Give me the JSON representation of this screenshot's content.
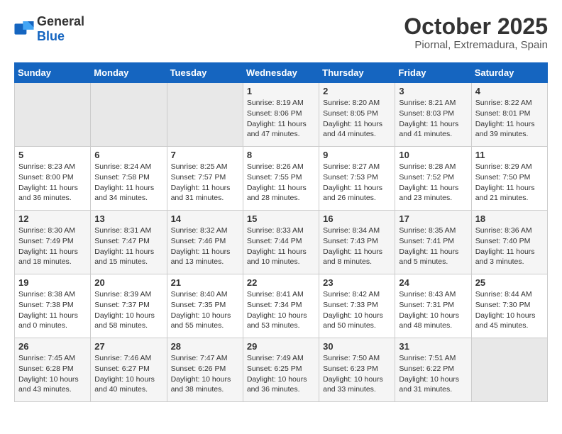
{
  "header": {
    "logo_general": "General",
    "logo_blue": "Blue",
    "month_title": "October 2025",
    "location": "Piornal, Extremadura, Spain"
  },
  "days_of_week": [
    "Sunday",
    "Monday",
    "Tuesday",
    "Wednesday",
    "Thursday",
    "Friday",
    "Saturday"
  ],
  "weeks": [
    [
      {
        "day": "",
        "info": ""
      },
      {
        "day": "",
        "info": ""
      },
      {
        "day": "",
        "info": ""
      },
      {
        "day": "1",
        "info": "Sunrise: 8:19 AM\nSunset: 8:06 PM\nDaylight: 11 hours and 47 minutes."
      },
      {
        "day": "2",
        "info": "Sunrise: 8:20 AM\nSunset: 8:05 PM\nDaylight: 11 hours and 44 minutes."
      },
      {
        "day": "3",
        "info": "Sunrise: 8:21 AM\nSunset: 8:03 PM\nDaylight: 11 hours and 41 minutes."
      },
      {
        "day": "4",
        "info": "Sunrise: 8:22 AM\nSunset: 8:01 PM\nDaylight: 11 hours and 39 minutes."
      }
    ],
    [
      {
        "day": "5",
        "info": "Sunrise: 8:23 AM\nSunset: 8:00 PM\nDaylight: 11 hours and 36 minutes."
      },
      {
        "day": "6",
        "info": "Sunrise: 8:24 AM\nSunset: 7:58 PM\nDaylight: 11 hours and 34 minutes."
      },
      {
        "day": "7",
        "info": "Sunrise: 8:25 AM\nSunset: 7:57 PM\nDaylight: 11 hours and 31 minutes."
      },
      {
        "day": "8",
        "info": "Sunrise: 8:26 AM\nSunset: 7:55 PM\nDaylight: 11 hours and 28 minutes."
      },
      {
        "day": "9",
        "info": "Sunrise: 8:27 AM\nSunset: 7:53 PM\nDaylight: 11 hours and 26 minutes."
      },
      {
        "day": "10",
        "info": "Sunrise: 8:28 AM\nSunset: 7:52 PM\nDaylight: 11 hours and 23 minutes."
      },
      {
        "day": "11",
        "info": "Sunrise: 8:29 AM\nSunset: 7:50 PM\nDaylight: 11 hours and 21 minutes."
      }
    ],
    [
      {
        "day": "12",
        "info": "Sunrise: 8:30 AM\nSunset: 7:49 PM\nDaylight: 11 hours and 18 minutes."
      },
      {
        "day": "13",
        "info": "Sunrise: 8:31 AM\nSunset: 7:47 PM\nDaylight: 11 hours and 15 minutes."
      },
      {
        "day": "14",
        "info": "Sunrise: 8:32 AM\nSunset: 7:46 PM\nDaylight: 11 hours and 13 minutes."
      },
      {
        "day": "15",
        "info": "Sunrise: 8:33 AM\nSunset: 7:44 PM\nDaylight: 11 hours and 10 minutes."
      },
      {
        "day": "16",
        "info": "Sunrise: 8:34 AM\nSunset: 7:43 PM\nDaylight: 11 hours and 8 minutes."
      },
      {
        "day": "17",
        "info": "Sunrise: 8:35 AM\nSunset: 7:41 PM\nDaylight: 11 hours and 5 minutes."
      },
      {
        "day": "18",
        "info": "Sunrise: 8:36 AM\nSunset: 7:40 PM\nDaylight: 11 hours and 3 minutes."
      }
    ],
    [
      {
        "day": "19",
        "info": "Sunrise: 8:38 AM\nSunset: 7:38 PM\nDaylight: 11 hours and 0 minutes."
      },
      {
        "day": "20",
        "info": "Sunrise: 8:39 AM\nSunset: 7:37 PM\nDaylight: 10 hours and 58 minutes."
      },
      {
        "day": "21",
        "info": "Sunrise: 8:40 AM\nSunset: 7:35 PM\nDaylight: 10 hours and 55 minutes."
      },
      {
        "day": "22",
        "info": "Sunrise: 8:41 AM\nSunset: 7:34 PM\nDaylight: 10 hours and 53 minutes."
      },
      {
        "day": "23",
        "info": "Sunrise: 8:42 AM\nSunset: 7:33 PM\nDaylight: 10 hours and 50 minutes."
      },
      {
        "day": "24",
        "info": "Sunrise: 8:43 AM\nSunset: 7:31 PM\nDaylight: 10 hours and 48 minutes."
      },
      {
        "day": "25",
        "info": "Sunrise: 8:44 AM\nSunset: 7:30 PM\nDaylight: 10 hours and 45 minutes."
      }
    ],
    [
      {
        "day": "26",
        "info": "Sunrise: 7:45 AM\nSunset: 6:28 PM\nDaylight: 10 hours and 43 minutes."
      },
      {
        "day": "27",
        "info": "Sunrise: 7:46 AM\nSunset: 6:27 PM\nDaylight: 10 hours and 40 minutes."
      },
      {
        "day": "28",
        "info": "Sunrise: 7:47 AM\nSunset: 6:26 PM\nDaylight: 10 hours and 38 minutes."
      },
      {
        "day": "29",
        "info": "Sunrise: 7:49 AM\nSunset: 6:25 PM\nDaylight: 10 hours and 36 minutes."
      },
      {
        "day": "30",
        "info": "Sunrise: 7:50 AM\nSunset: 6:23 PM\nDaylight: 10 hours and 33 minutes."
      },
      {
        "day": "31",
        "info": "Sunrise: 7:51 AM\nSunset: 6:22 PM\nDaylight: 10 hours and 31 minutes."
      },
      {
        "day": "",
        "info": ""
      }
    ]
  ]
}
